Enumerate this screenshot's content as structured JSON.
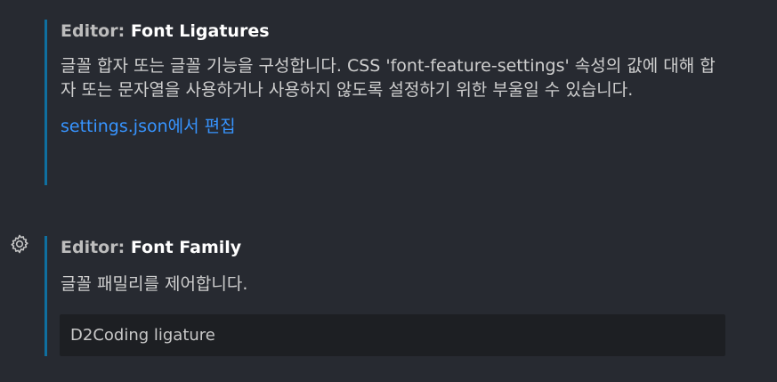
{
  "settings": [
    {
      "category": "Editor: ",
      "name": "Font Ligatures",
      "description": "글꼴 합자 또는 글꼴 기능을 구성합니다. CSS 'font-feature-settings' 속성의 값에 대해 합자 또는 문자열을 사용하거나 사용하지 않도록 설정하기 위한 부울일 수 있습니다.",
      "link": "settings.json에서 편집"
    },
    {
      "category": "Editor: ",
      "name": "Font Family",
      "description": "글꼴 패밀리를 제어합니다.",
      "value": "D2Coding ligature",
      "icon": "gear-icon"
    }
  ],
  "colors": {
    "background": "#272a31",
    "accent_border": "#0f6f9f",
    "link": "#3794ff",
    "input_bg": "#1d1f23"
  }
}
